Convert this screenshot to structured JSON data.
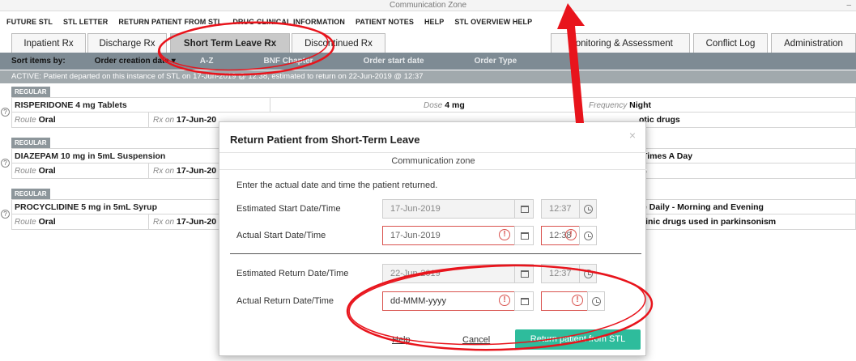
{
  "window": {
    "title": "Communication Zone",
    "minimize": "–"
  },
  "menu": [
    "FUTURE STL",
    "STL LETTER",
    "RETURN PATIENT FROM STL",
    "DRUG CLINICAL INFORMATION",
    "PATIENT NOTES",
    "HELP",
    "STL OVERVIEW HELP"
  ],
  "tabs": {
    "left": [
      "Inpatient Rx",
      "Discharge Rx",
      "Short Term Leave Rx",
      "Discontinued Rx"
    ],
    "right": [
      "Monitoring & Assessment",
      "Conflict Log",
      "Administration"
    ],
    "active": "Short Term Leave Rx"
  },
  "sortbar": {
    "label": "Sort items by:",
    "selected": "Order creation date",
    "options": [
      "A-Z",
      "BNF Chapter",
      "Order start date",
      "Order Type"
    ]
  },
  "status": "ACTIVE: Patient departed on this instance of STL on 17-Jun-2019 @ 12:38, estimated to return on 22-Jun-2019 @ 12:37",
  "orders": [
    {
      "badge": "REGULAR",
      "name": "RISPERIDONE 4 mg Tablets",
      "dose_label": "Dose",
      "dose": "4 mg",
      "freq_label": "Frequency",
      "frequency": "Night",
      "route_label": "Route",
      "route": "Oral",
      "rx_label": "Rx on",
      "rx_on": "17-Jun-20",
      "bnf": "otic drugs"
    },
    {
      "badge": "REGULAR",
      "name": "DIAZEPAM 10 mg in 5mL Suspension",
      "frequency": "Times A Day",
      "route_label": "Route",
      "route": "Oral",
      "rx_label": "Rx on",
      "rx_on": "17-Jun-20",
      "bnf": "s"
    },
    {
      "badge": "REGULAR",
      "name": "PROCYCLIDINE 5 mg in 5mL Syrup",
      "frequency": "e Daily - Morning and Evening",
      "route_label": "Route",
      "route": "Oral",
      "rx_label": "Rx on",
      "rx_on": "17-Jun-20",
      "bnf": "rinic drugs used in parkinsonism"
    }
  ],
  "modal": {
    "title": "Return Patient from Short-Term Leave",
    "close": "×",
    "subtitle": "Communication zone",
    "instruction": "Enter the actual date and time the patient returned.",
    "est_start": {
      "label": "Estimated Start Date/Time",
      "date": "17-Jun-2019",
      "time": "12:37"
    },
    "act_start": {
      "label": "Actual Start Date/Time",
      "date": "17-Jun-2019",
      "time": "12:38"
    },
    "est_return": {
      "label": "Estimated Return Date/Time",
      "date": "22-Jun-2019",
      "time": "12:37"
    },
    "act_return": {
      "label": "Actual Return Date/Time",
      "date_placeholder": "dd-MMM-yyyy",
      "time": ""
    },
    "error_glyph": "!",
    "help": "Help",
    "cancel": "Cancel",
    "submit": "Return patient from STL"
  },
  "colors": {
    "accent": "#2ebc9c",
    "error": "#d9534f",
    "annotation": "#e8141c",
    "sortbar": "#7e8b94"
  }
}
